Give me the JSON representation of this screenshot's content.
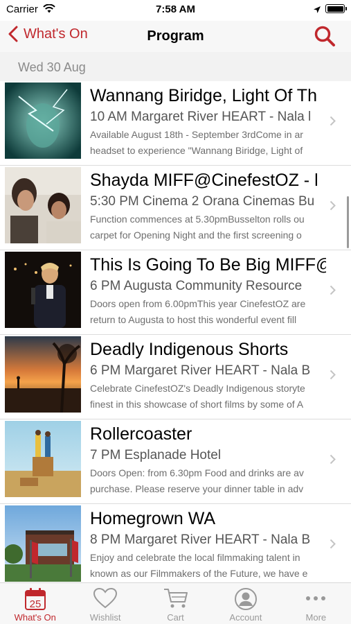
{
  "status": {
    "carrier": "Carrier",
    "time": "7:58 AM"
  },
  "nav": {
    "back_label": "What's On",
    "title": "Program"
  },
  "section": {
    "date": "Wed 30 Aug"
  },
  "events": [
    {
      "title": "Wannang Biridge, Light Of Th",
      "subtitle": "10 AM Margaret River HEART - Nala l",
      "desc1": "Available August 18th - September 3rdCome in ar",
      "desc2": "headset to experience \"Wannang Biridge, Light of"
    },
    {
      "title": "Shayda MIFF@CinefestOZ  - l",
      "subtitle": "5:30 PM Cinema 2 Orana Cinemas Bu",
      "desc1": "Function commences at 5.30pmBusselton rolls ou",
      "desc2": "carpet for Opening Night and the first screening o"
    },
    {
      "title": "This Is Going To Be Big MIFF@",
      "subtitle": "6 PM Augusta Community Resource",
      "desc1": "Doors open from 6.00pmThis year CinefestOZ are",
      "desc2": "return to Augusta to host this wonderful event fill"
    },
    {
      "title": "Deadly Indigenous Shorts",
      "subtitle": "6 PM Margaret River HEART - Nala B",
      "desc1": "Celebrate CinefestOZ's Deadly Indigenous storyte",
      "desc2": "finest in this showcase of short films by some of A"
    },
    {
      "title": "Rollercoaster",
      "subtitle": "7 PM Esplanade Hotel",
      "desc1": "Doors Open:  from 6.30pm Food and drinks are av",
      "desc2": "purchase. Please reserve your dinner table in adv"
    },
    {
      "title": "Homegrown WA",
      "subtitle": "8 PM Margaret River HEART - Nala B",
      "desc1": "Enjoy and celebrate the local filmmaking talent in",
      "desc2": "known as our Filmmakers of the Future, we have e"
    }
  ],
  "tabs": {
    "whats_on": {
      "label": "What's On",
      "day": "25"
    },
    "wishlist": {
      "label": "Wishlist"
    },
    "cart": {
      "label": "Cart"
    },
    "account": {
      "label": "Account"
    },
    "more": {
      "label": "More"
    }
  },
  "colors": {
    "accent": "#c0282d",
    "inactive": "#999999",
    "section_bg": "#f2f2f2"
  }
}
